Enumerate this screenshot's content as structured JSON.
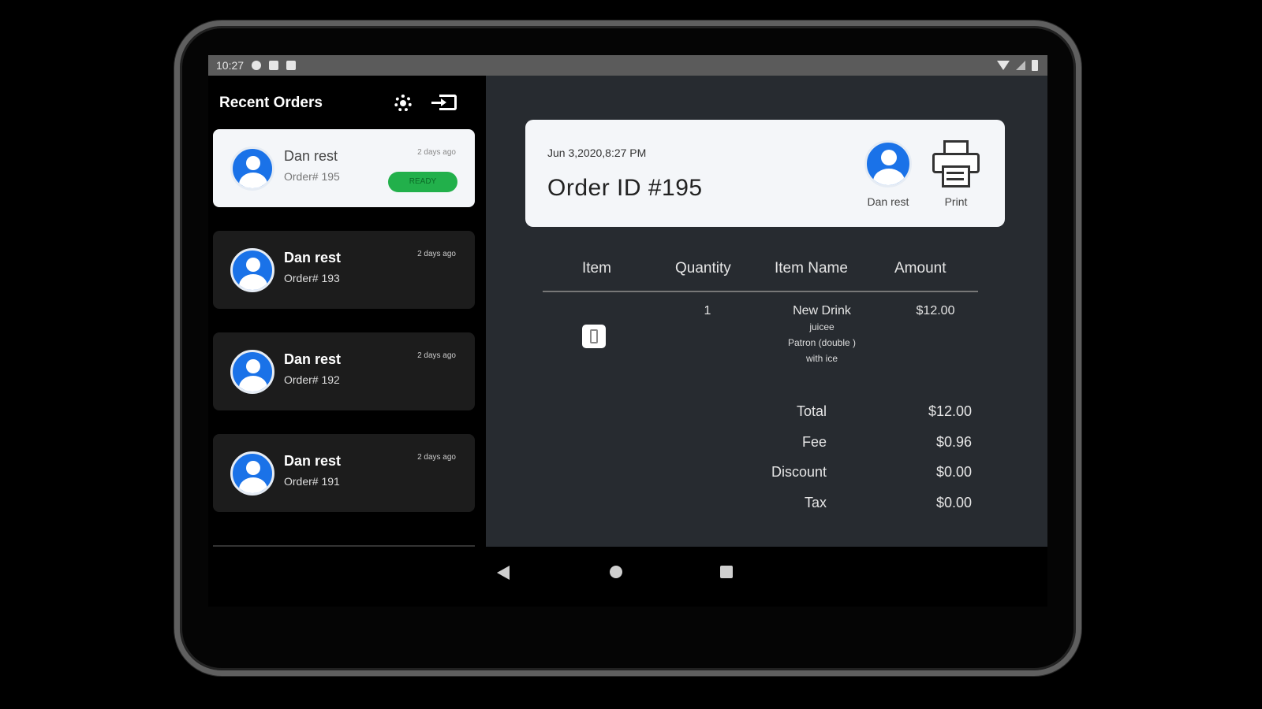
{
  "status_bar": {
    "time": "10:27"
  },
  "left_panel": {
    "title": "Recent Orders",
    "orders": [
      {
        "name": "Dan rest",
        "order_number": "Order# 195",
        "time_ago": "2 days ago",
        "badge": "READY"
      },
      {
        "name": "Dan rest",
        "order_number": "Order# 193",
        "time_ago": "2 days ago"
      },
      {
        "name": "Dan rest",
        "order_number": "Order# 192",
        "time_ago": "2 days ago"
      },
      {
        "name": "Dan rest",
        "order_number": "Order# 191",
        "time_ago": "2 days ago"
      }
    ]
  },
  "detail": {
    "date": "Jun 3,2020,8:27 PM",
    "title": "Order ID #195",
    "customer_label": "Dan rest",
    "print_label": "Print"
  },
  "table": {
    "headers": [
      "Item",
      "Quantity",
      "Item Name",
      "Amount"
    ],
    "rows": [
      {
        "quantity": "1",
        "item_name": "New Drink",
        "modifiers": [
          "juicee",
          "Patron (double )",
          "with ice"
        ],
        "amount": "$12.00"
      }
    ]
  },
  "summary": {
    "total_label": "Total",
    "total_value": "$12.00",
    "fee_label": "Fee",
    "fee_value": "$0.96",
    "discount_label": "Discount",
    "discount_value": "$0.00",
    "tax_label": "Tax",
    "tax_value": "$0.00"
  },
  "colors": {
    "accent_blue": "#1a72e8",
    "ready_green": "#22b04b",
    "panel_dark": "#272b30"
  }
}
